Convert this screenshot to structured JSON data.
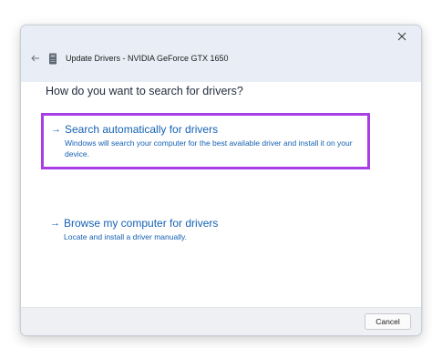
{
  "window": {
    "title": "Update Drivers - NVIDIA GeForce GTX 1650",
    "close_icon": "close-icon",
    "back_icon": "back-arrow-icon",
    "device_icon": "device-chip-icon"
  },
  "main": {
    "heading": "How do you want to search for drivers?",
    "options": [
      {
        "title": "Search automatically for drivers",
        "description": "Windows will search your computer for the best available driver and install it on your device.",
        "highlighted": true,
        "highlight_color": "#a93ee6"
      },
      {
        "title": "Browse my computer for drivers",
        "description": "Locate and install a driver manually.",
        "highlighted": false
      }
    ]
  },
  "footer": {
    "cancel_label": "Cancel"
  },
  "colors": {
    "link": "#1561b3",
    "titlebar": "#e9eef6",
    "footer": "#eef0f3"
  }
}
